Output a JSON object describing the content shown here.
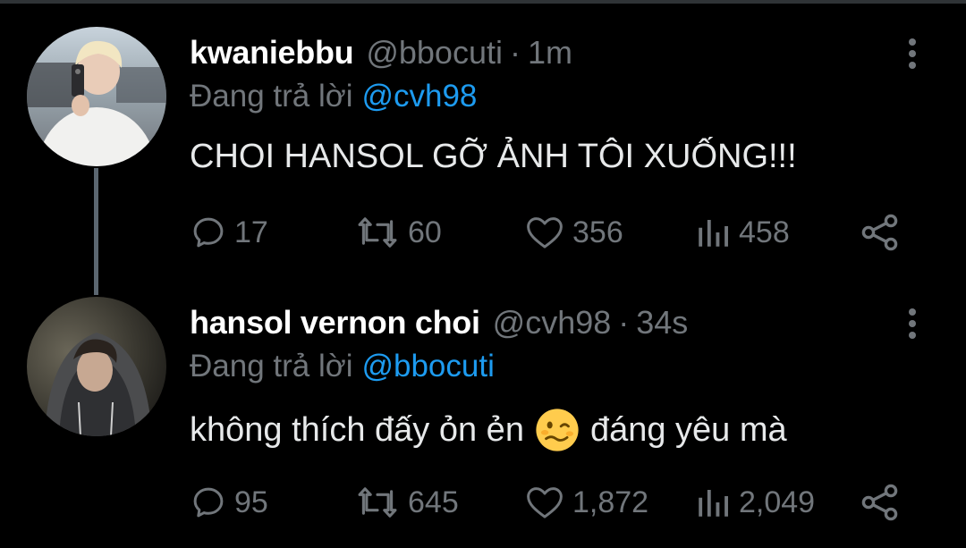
{
  "thread": [
    {
      "display_name": "kwaniebbu",
      "handle": "@bbocuti",
      "separator": "·",
      "time": "1m",
      "reply_prefix": "Đang trả lời",
      "reply_to": "@cvh98",
      "text_before": "CHOI HANSOL GỠ ẢNH TÔI XUỐNG!!!",
      "emoji": "",
      "text_after": "",
      "stats": {
        "replies": "17",
        "retweets": "60",
        "likes": "356",
        "views": "458"
      }
    },
    {
      "display_name": "hansol vernon choi",
      "handle": "@cvh98",
      "separator": "·",
      "time": "34s",
      "reply_prefix": "Đang trả lời",
      "reply_to": "@bbocuti",
      "text_before": "không thích đấy ỏn ẻn",
      "emoji": "woozy-face",
      "text_after": "đáng yêu mà",
      "stats": {
        "replies": "95",
        "retweets": "645",
        "likes": "1,872",
        "views": "2,049"
      }
    }
  ],
  "theme": {
    "background": "#000000",
    "text": "#e7e9ea",
    "muted": "#71767b",
    "link": "#1d9bf0",
    "thread_line": "#5b6670"
  },
  "icons": {
    "reply": "speech-bubble-icon",
    "retweet": "retweet-icon",
    "like": "heart-icon",
    "views": "bar-chart-icon",
    "share": "share-icon",
    "more": "vertical-dots-icon"
  }
}
